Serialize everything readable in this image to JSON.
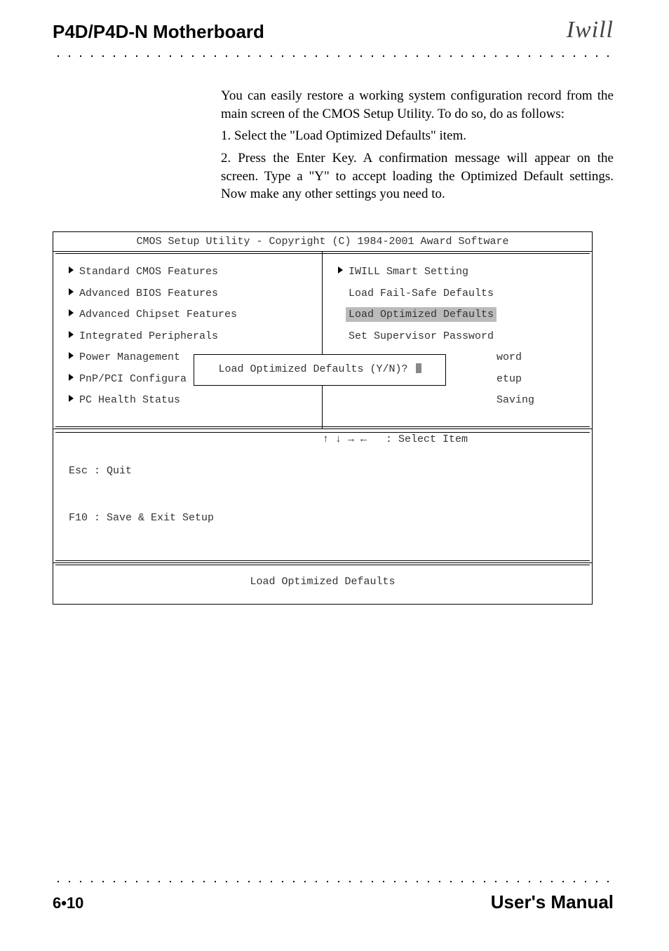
{
  "header": {
    "title": "P4D/P4D-N Motherboard",
    "logo": "Iwill"
  },
  "body": {
    "p1": "You can easily restore a working system configuration record from the main screen of the CMOS Setup Utility. To do so, do as follows:",
    "p2": "1. Select the \"Load Optimized Defaults\" item.",
    "p3": "2. Press the Enter Key. A confirmation message will appear on the screen. Type a \"Y\" to accept loading the Optimized Default settings. Now make any other settings you need to."
  },
  "bios": {
    "title": "CMOS Setup Utility - Copyright (C) 1984-2001 Award Software",
    "left_items": [
      {
        "arrow": true,
        "label": "Standard CMOS Features"
      },
      {
        "arrow": true,
        "label": "Advanced BIOS Features"
      },
      {
        "arrow": true,
        "label": "Advanced Chipset Features"
      },
      {
        "arrow": true,
        "label": "Integrated Peripherals"
      },
      {
        "arrow": true,
        "label": "Power Management"
      },
      {
        "arrow": true,
        "label": "PnP/PCI Configura"
      },
      {
        "arrow": true,
        "label": "PC Health Status"
      }
    ],
    "right_items": [
      {
        "arrow": true,
        "label": "IWILL Smart Setting",
        "highlight": false
      },
      {
        "arrow": false,
        "label": "Load Fail-Safe Defaults",
        "highlight": false
      },
      {
        "arrow": false,
        "label": "Load Optimized Defaults",
        "highlight": true
      },
      {
        "arrow": false,
        "label": "Set Supervisor Password",
        "highlight": false
      },
      {
        "arrow": false,
        "label": "word",
        "highlight": false,
        "tail": true
      },
      {
        "arrow": false,
        "label": "etup",
        "highlight": false,
        "tail": true
      },
      {
        "arrow": false,
        "label": "Saving",
        "highlight": false,
        "tail": true
      }
    ],
    "popup": "Load Optimized Defaults (Y/N)? ",
    "help_left_1": "Esc : Quit",
    "help_left_2": "F10 : Save & Exit Setup",
    "help_right": "↑ ↓ → ←   : Select Item",
    "status": "Load Optimized Defaults"
  },
  "footer": {
    "page": "6•10",
    "manual": "User's Manual"
  }
}
